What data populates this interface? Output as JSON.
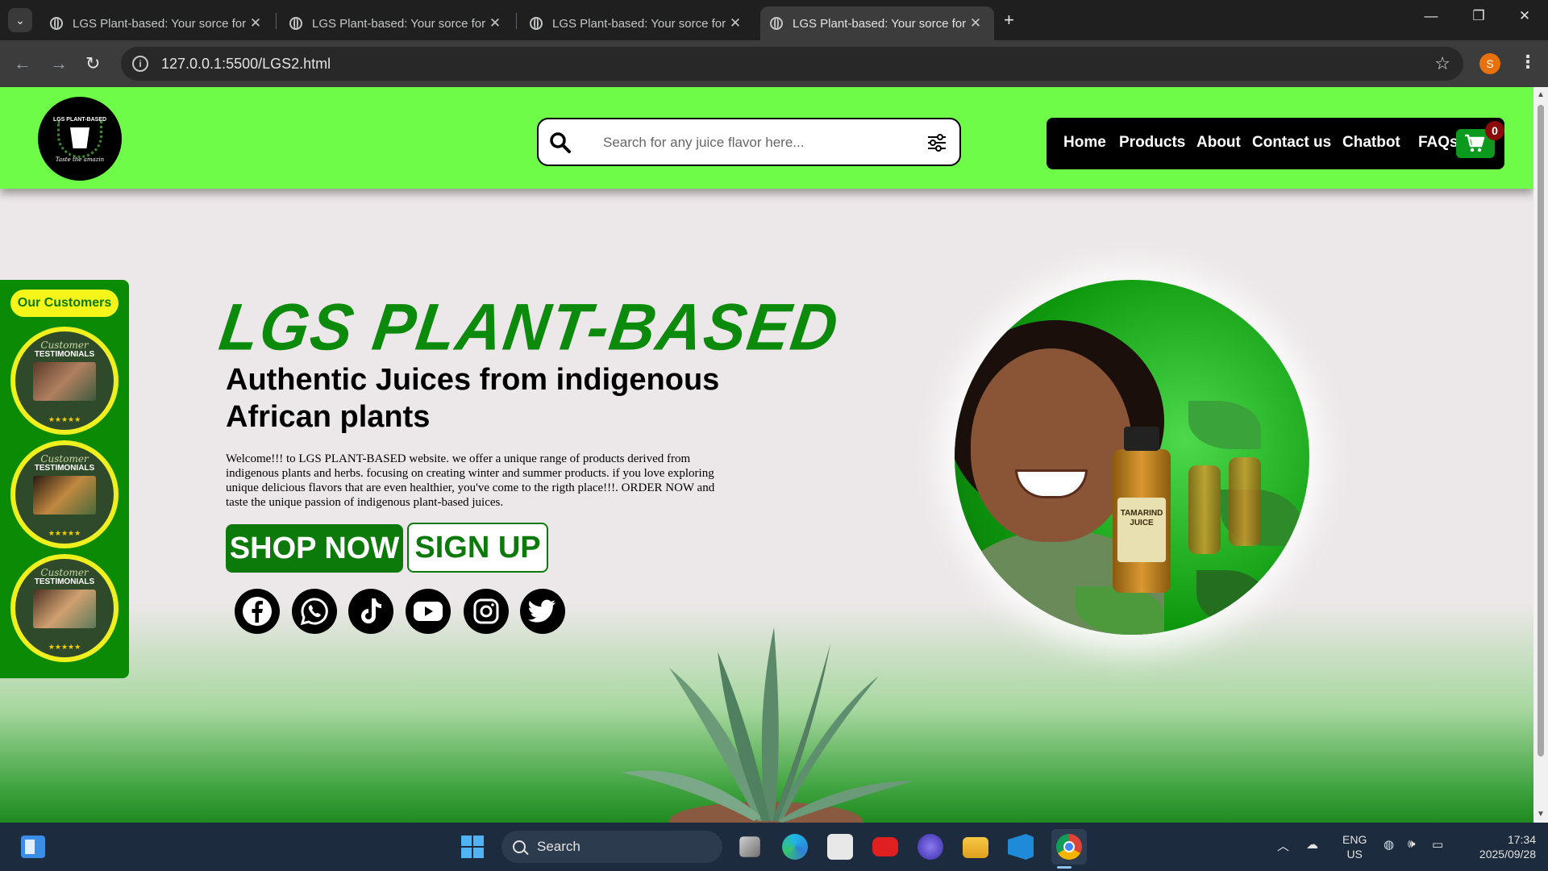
{
  "browser": {
    "tabs": [
      {
        "title": "LGS Plant-based: Your sorce for",
        "active": false
      },
      {
        "title": "LGS Plant-based: Your sorce for",
        "active": false
      },
      {
        "title": "LGS Plant-based: Your sorce for",
        "active": false
      },
      {
        "title": "LGS Plant-based: Your sorce for",
        "active": true
      }
    ],
    "url": "127.0.0.1:5500/LGS2.html",
    "profile_initial": "S"
  },
  "header": {
    "logo_title": "LGS PLANT-BASED",
    "logo_tagline": "Taste the amazin",
    "search_placeholder": "Search for any juice flavor here...",
    "nav": [
      "Home",
      "Products",
      "About",
      "Contact us",
      "Chatbot",
      "FAQs"
    ],
    "cart_count": "0"
  },
  "customers": {
    "title": "Our Customers",
    "cards": [
      {
        "script": "Customer",
        "heading": "TESTIMONIALS",
        "stars": "★★★★★"
      },
      {
        "script": "Customer",
        "heading": "TESTIMONIALS",
        "stars": "★★★★★"
      },
      {
        "script": "Customer",
        "heading": "TESTIMONIALS",
        "stars": "★★★★★"
      }
    ]
  },
  "hero": {
    "brand": "LGS PLANT-BASED",
    "tagline": "Authentic Juices from indigenous African plants",
    "intro": "Welcome!!! to LGS PLANT-BASED website. we offer a unique range of products derived from indigenous plants and herbs. focusing on creating winter and summer products. if you love exploring unique delicious flavors that are even healthier, you've come to the rigth place!!!. ORDER NOW and taste the unique passion of indigenous plant-based juices.",
    "shop_label": "SHOP NOW",
    "signup_label": "SIGN UP",
    "socials": [
      "facebook-icon",
      "whatsapp-icon",
      "tiktok-icon",
      "youtube-icon",
      "instagram-icon",
      "twitter-icon"
    ],
    "bottle_label": "TAMARIND JUICE"
  },
  "colors": {
    "header_green": "#6efc48",
    "brand_green": "#0b8a0b",
    "nav_black": "#000000",
    "accent_yellow": "#f5f51a"
  },
  "taskbar": {
    "search_label": "Search",
    "lang_line1": "ENG",
    "lang_line2": "US",
    "time": "17:34",
    "date": "2025/09/28"
  }
}
